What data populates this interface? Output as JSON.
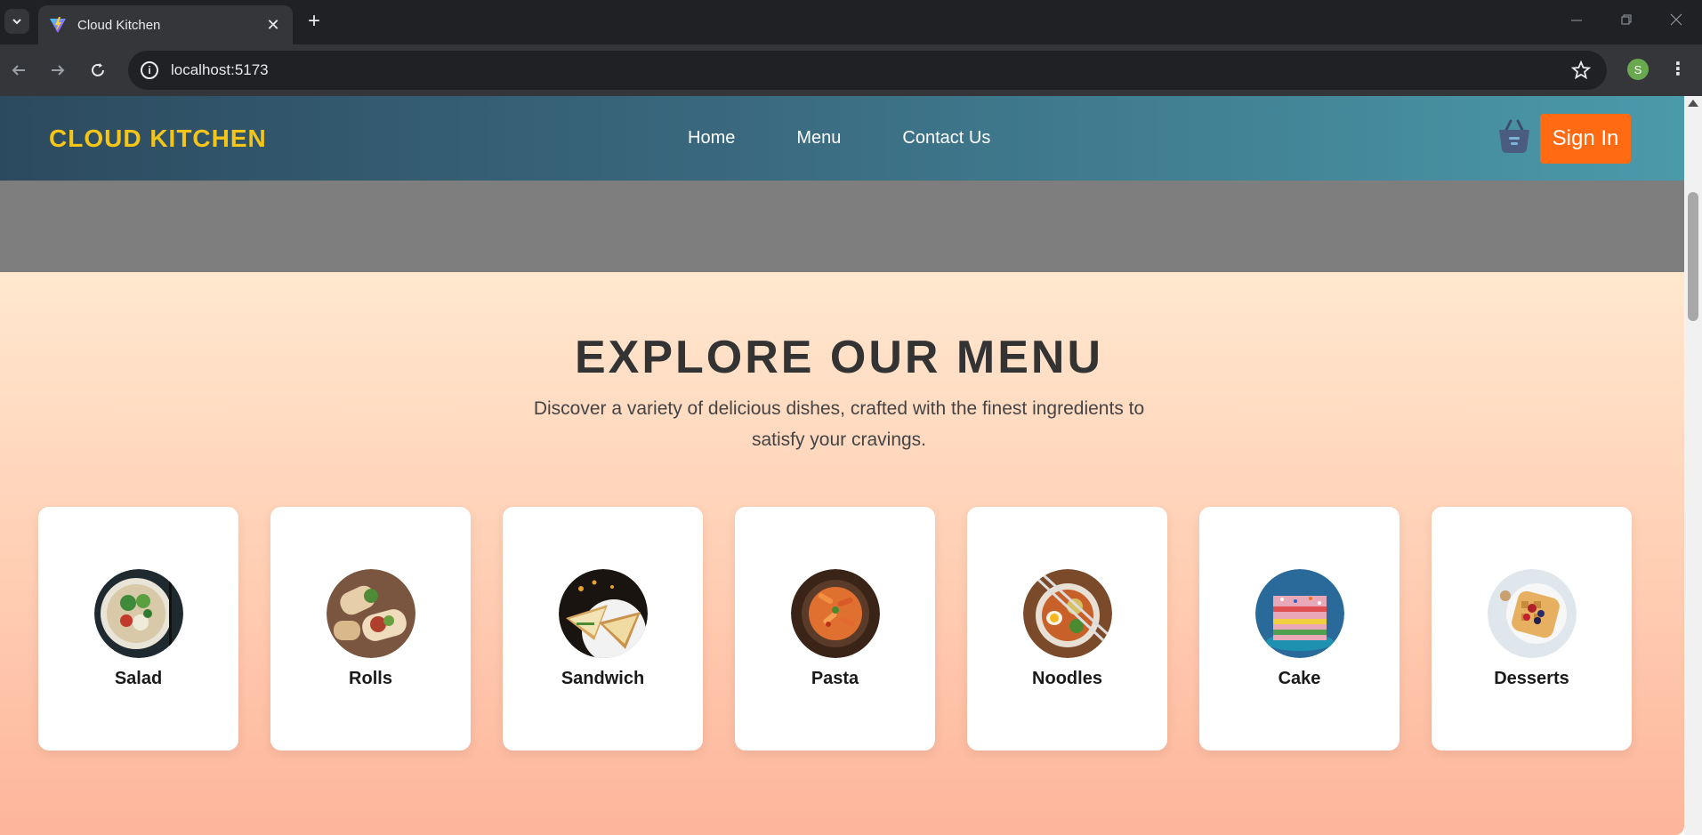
{
  "browser": {
    "tab_title": "Cloud Kitchen",
    "url": "localhost:5173",
    "profile_initial": "S",
    "new_tab_symbol": "+",
    "close_tab_symbol": "✕"
  },
  "header": {
    "logo": "CLOUD KITCHEN",
    "nav": [
      {
        "label": "Home"
      },
      {
        "label": "Menu"
      },
      {
        "label": "Contact Us"
      }
    ],
    "basket_icon": "basket-icon",
    "signin_label": "Sign In"
  },
  "menu": {
    "title": "EXPLORE OUR MENU",
    "subtitle": "Discover a variety of delicious dishes, crafted with the finest ingredients to satisfy your cravings.",
    "categories": [
      {
        "label": "Salad"
      },
      {
        "label": "Rolls"
      },
      {
        "label": "Sandwich"
      },
      {
        "label": "Pasta"
      },
      {
        "label": "Noodles"
      },
      {
        "label": "Cake"
      },
      {
        "label": "Desserts"
      }
    ]
  },
  "colors": {
    "logo": "#f5c518",
    "signin_bg": "#ff6a13",
    "header_start": "#2c4a5f",
    "header_end": "#4a9aaa",
    "section_top": "#ffe8cf",
    "section_bottom": "#fdb59b"
  }
}
